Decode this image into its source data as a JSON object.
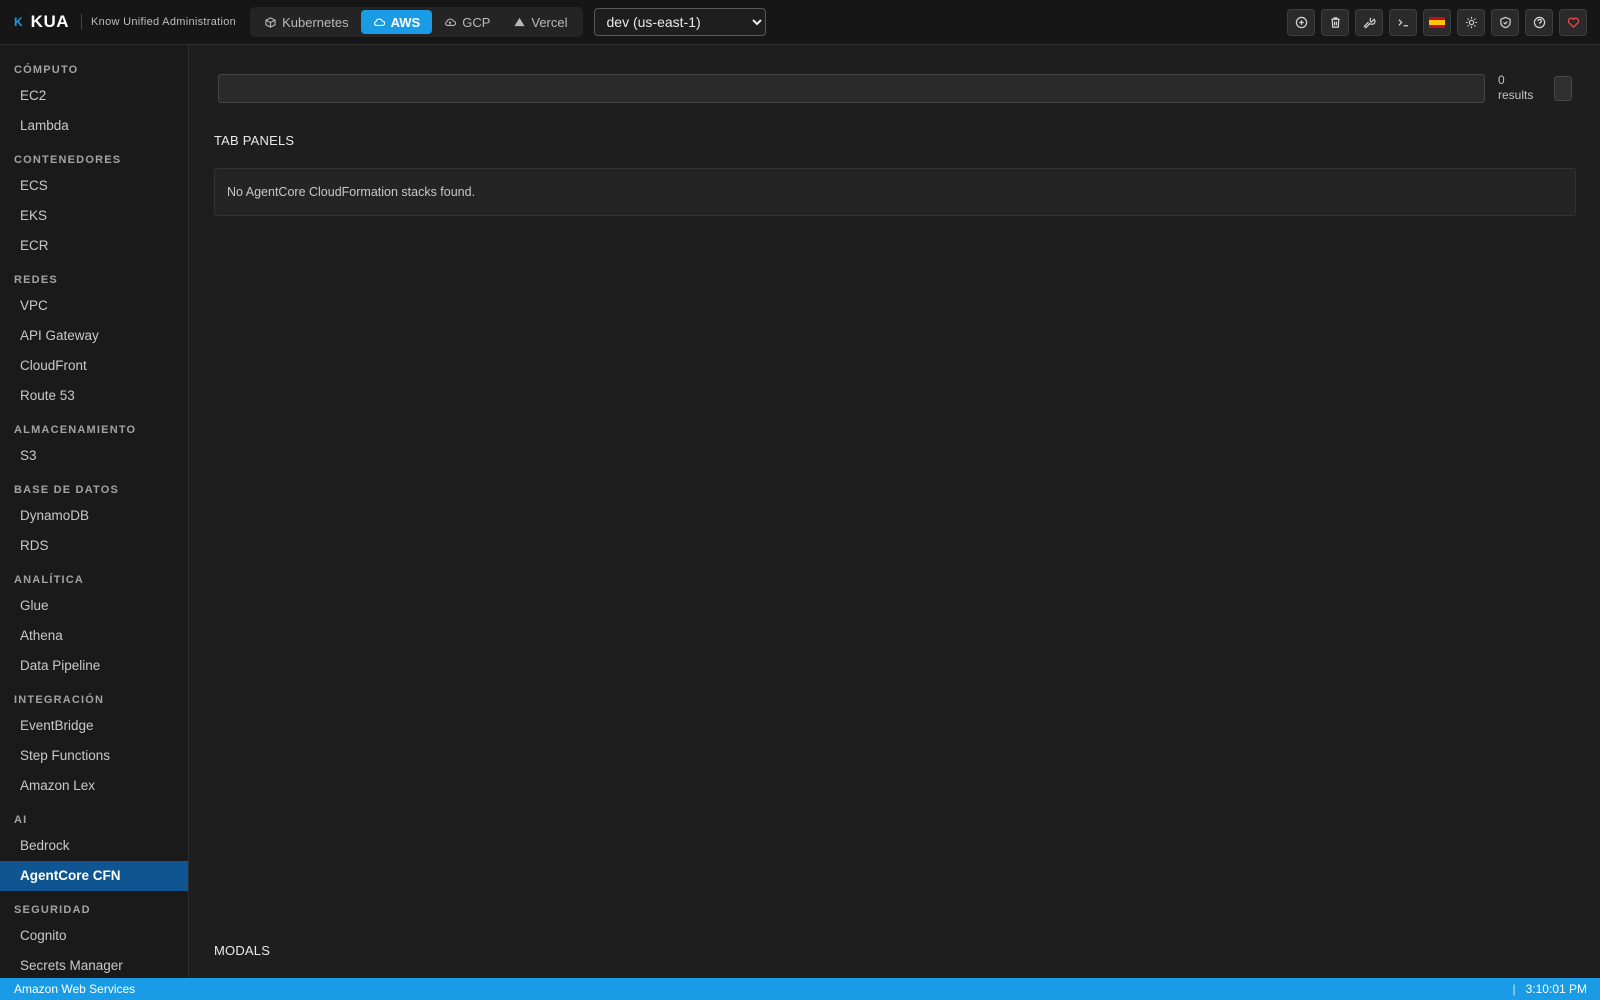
{
  "brand": {
    "name": "KUA",
    "subtitle": "Know Unified Administration"
  },
  "providers": [
    {
      "label": "Kubernetes",
      "icon": "cube-icon",
      "active": false
    },
    {
      "label": "AWS",
      "icon": "cloud-icon",
      "active": true
    },
    {
      "label": "GCP",
      "icon": "cloud-upload-icon",
      "active": false
    },
    {
      "label": "Vercel",
      "icon": "triangle-icon",
      "active": false
    }
  ],
  "environment": {
    "selected": "dev (us-east-1)"
  },
  "header_actions": [
    "add-circle-icon",
    "trash-icon",
    "wrench-icon",
    "terminal-icon",
    "spain-flag-icon",
    "sun-icon",
    "shield-icon",
    "help-icon",
    "heart-icon"
  ],
  "sidebar": {
    "groups": [
      {
        "title": "CÓMPUTO",
        "items": [
          "EC2",
          "Lambda"
        ]
      },
      {
        "title": "CONTENEDORES",
        "items": [
          "ECS",
          "EKS",
          "ECR"
        ]
      },
      {
        "title": "REDES",
        "items": [
          "VPC",
          "API Gateway",
          "CloudFront",
          "Route 53"
        ]
      },
      {
        "title": "ALMACENAMIENTO",
        "items": [
          "S3"
        ]
      },
      {
        "title": "BASE DE DATOS",
        "items": [
          "DynamoDB",
          "RDS"
        ]
      },
      {
        "title": "ANALÍTICA",
        "items": [
          "Glue",
          "Athena",
          "Data Pipeline"
        ]
      },
      {
        "title": "INTEGRACIÓN",
        "items": [
          "EventBridge",
          "Step Functions",
          "Amazon Lex"
        ]
      },
      {
        "title": "AI",
        "items": [
          "Bedrock",
          "AgentCore CFN"
        ]
      },
      {
        "title": "SEGURIDAD",
        "items": [
          "Cognito",
          "Secrets Manager"
        ]
      }
    ],
    "active_item": "AgentCore CFN"
  },
  "main": {
    "search": {
      "value": "",
      "placeholder": ""
    },
    "results": {
      "count": "0",
      "label": "results"
    },
    "tab_panels_title": "TAB PANELS",
    "empty_message": "No AgentCore CloudFormation stacks found.",
    "modals_title": "MODALS"
  },
  "statusbar": {
    "left": "Amazon Web Services",
    "time": "3:10:01 PM"
  },
  "colors": {
    "accent": "#1a9be6",
    "active_sidebar": "#0f5591",
    "heart": "#e5484d"
  }
}
